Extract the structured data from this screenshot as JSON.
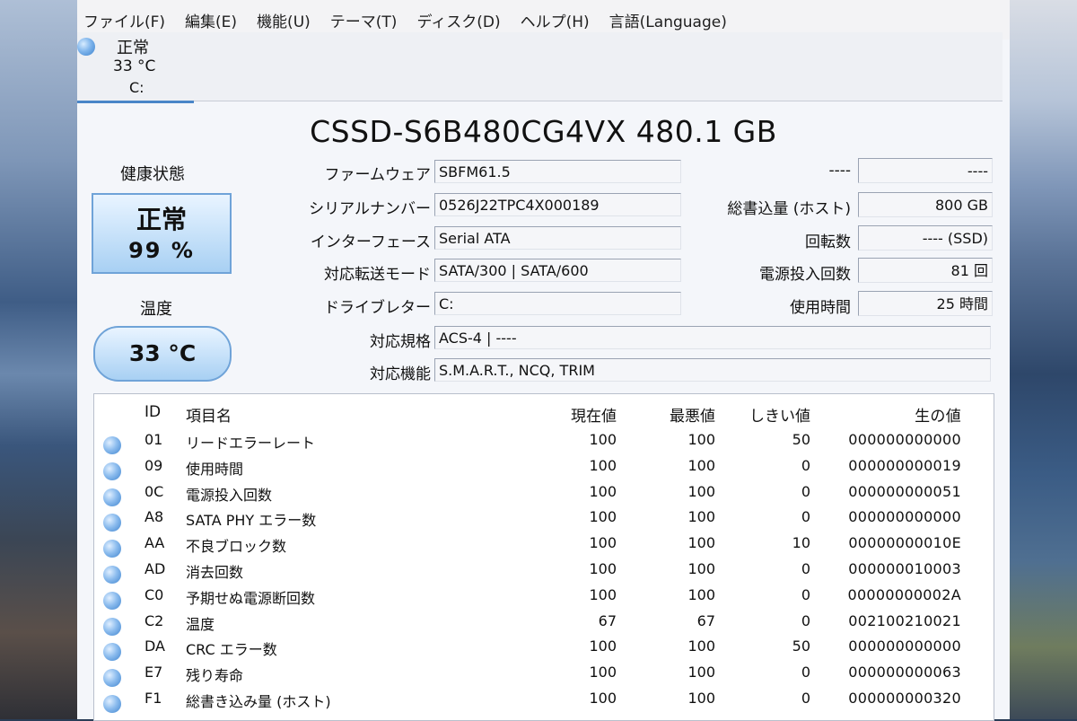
{
  "menu": [
    "ファイル(F)",
    "編集(E)",
    "機能(U)",
    "テーマ(T)",
    "ディスク(D)",
    "ヘルプ(H)",
    "言語(Language)"
  ],
  "drive_tab": {
    "status": "正常",
    "temp": "33 °C",
    "letter": "C:"
  },
  "model": "CSSD-S6B480CG4VX 480.1 GB",
  "health": {
    "label": "健康状態",
    "status": "正常",
    "percent": "99 %"
  },
  "temperature": {
    "label": "温度",
    "value": "33 °C"
  },
  "info": {
    "firmware": {
      "label": "ファームウェア",
      "value": "SBFM61.5"
    },
    "serial": {
      "label": "シリアルナンバー",
      "value": "0526J22TPC4X000189"
    },
    "interface": {
      "label": "インターフェース",
      "value": "Serial ATA"
    },
    "transfer": {
      "label": "対応転送モード",
      "value": "SATA/300 | SATA/600"
    },
    "drive_letter": {
      "label": "ドライブレター",
      "value": "C:"
    },
    "standard": {
      "label": "対応規格",
      "value": "ACS-4 | ----"
    },
    "features": {
      "label": "対応機能",
      "value": "S.M.A.R.T., NCQ, TRIM"
    }
  },
  "right_info": {
    "blank": {
      "label": "----",
      "value": "----"
    },
    "host_writes": {
      "label": "総書込量 (ホスト)",
      "value": "800 GB"
    },
    "rotation": {
      "label": "回転数",
      "value": "---- (SSD)"
    },
    "power_count": {
      "label": "電源投入回数",
      "value": "81 回"
    },
    "power_hours": {
      "label": "使用時間",
      "value": "25 時間"
    }
  },
  "smart": {
    "headers": {
      "id": "ID",
      "name": "項目名",
      "current": "現在値",
      "worst": "最悪値",
      "threshold": "しきい値",
      "raw": "生の値"
    },
    "rows": [
      {
        "id": "01",
        "name": "リードエラーレート",
        "current": "100",
        "worst": "100",
        "threshold": "50",
        "raw": "000000000000"
      },
      {
        "id": "09",
        "name": "使用時間",
        "current": "100",
        "worst": "100",
        "threshold": "0",
        "raw": "000000000019"
      },
      {
        "id": "0C",
        "name": "電源投入回数",
        "current": "100",
        "worst": "100",
        "threshold": "0",
        "raw": "000000000051"
      },
      {
        "id": "A8",
        "name": "SATA PHY エラー数",
        "current": "100",
        "worst": "100",
        "threshold": "0",
        "raw": "000000000000"
      },
      {
        "id": "AA",
        "name": "不良ブロック数",
        "current": "100",
        "worst": "100",
        "threshold": "10",
        "raw": "00000000010E"
      },
      {
        "id": "AD",
        "name": "消去回数",
        "current": "100",
        "worst": "100",
        "threshold": "0",
        "raw": "000000010003"
      },
      {
        "id": "C0",
        "name": "予期せぬ電源断回数",
        "current": "100",
        "worst": "100",
        "threshold": "0",
        "raw": "00000000002A"
      },
      {
        "id": "C2",
        "name": "温度",
        "current": "67",
        "worst": "67",
        "threshold": "0",
        "raw": "002100210021"
      },
      {
        "id": "DA",
        "name": "CRC エラー数",
        "current": "100",
        "worst": "100",
        "threshold": "50",
        "raw": "000000000000"
      },
      {
        "id": "E7",
        "name": "残り寿命",
        "current": "100",
        "worst": "100",
        "threshold": "0",
        "raw": "000000000063"
      },
      {
        "id": "F1",
        "name": "総書き込み量 (ホスト)",
        "current": "100",
        "worst": "100",
        "threshold": "0",
        "raw": "000000000320"
      }
    ]
  }
}
